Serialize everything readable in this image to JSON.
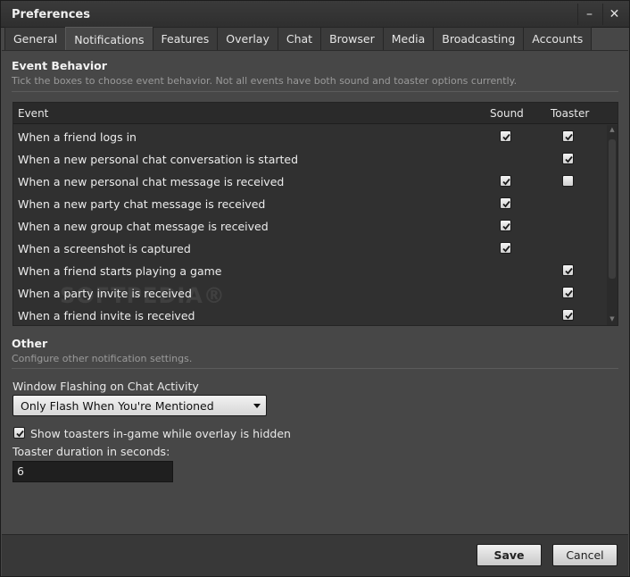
{
  "window": {
    "title": "Preferences",
    "minimize_glyph": "–",
    "close_glyph": "✕"
  },
  "tabs": [
    {
      "label": "General",
      "active": false
    },
    {
      "label": "Notifications",
      "active": true
    },
    {
      "label": "Features",
      "active": false
    },
    {
      "label": "Overlay",
      "active": false
    },
    {
      "label": "Chat",
      "active": false
    },
    {
      "label": "Browser",
      "active": false
    },
    {
      "label": "Media",
      "active": false
    },
    {
      "label": "Broadcasting",
      "active": false
    },
    {
      "label": "Accounts",
      "active": false
    }
  ],
  "event_behavior": {
    "title": "Event Behavior",
    "description": "Tick the boxes to choose event behavior. Not all events have both sound and toaster options currently.",
    "columns": {
      "event": "Event",
      "sound": "Sound",
      "toaster": "Toaster"
    },
    "rows": [
      {
        "event": "When a friend logs in",
        "sound": true,
        "toaster": true
      },
      {
        "event": "When a new personal chat conversation is started",
        "sound": null,
        "toaster": true
      },
      {
        "event": "When a new personal chat message is received",
        "sound": true,
        "toaster": false
      },
      {
        "event": "When a new party chat message is received",
        "sound": true,
        "toaster": null
      },
      {
        "event": "When a new group chat message is received",
        "sound": true,
        "toaster": null
      },
      {
        "event": "When a screenshot is captured",
        "sound": true,
        "toaster": null
      },
      {
        "event": "When a friend starts playing a game",
        "sound": null,
        "toaster": true
      },
      {
        "event": "When a party invite is received",
        "sound": null,
        "toaster": true
      },
      {
        "event": "When a friend invite is received",
        "sound": null,
        "toaster": true
      }
    ],
    "watermark": "SOFTPEDIA®"
  },
  "other": {
    "title": "Other",
    "description": "Configure other notification settings.",
    "window_flashing_label": "Window Flashing on Chat Activity",
    "window_flashing_value": "Only Flash When You're Mentioned",
    "show_toasters_label": "Show toasters in-game while overlay is hidden",
    "show_toasters_checked": true,
    "toaster_duration_label": "Toaster duration in seconds:",
    "toaster_duration_value": "6"
  },
  "footer": {
    "save_label": "Save",
    "cancel_label": "Cancel"
  }
}
